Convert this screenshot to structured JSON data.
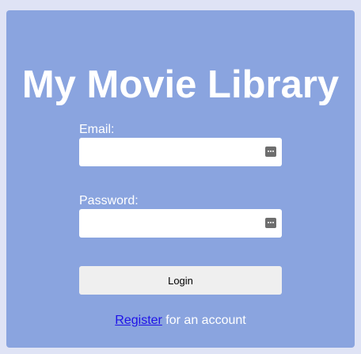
{
  "app": {
    "title": "My Movie Library"
  },
  "form": {
    "email_label": "Email:",
    "email_value": "",
    "password_label": "Password:",
    "password_value": "",
    "login_label": "Login",
    "field_icon": "password-manager-icon"
  },
  "footer": {
    "register_link": "Register",
    "register_suffix": " for an account"
  },
  "colors": {
    "page_background": "#dfe3f5",
    "card_background": "#8aa4df",
    "link": "#1f12e8"
  }
}
